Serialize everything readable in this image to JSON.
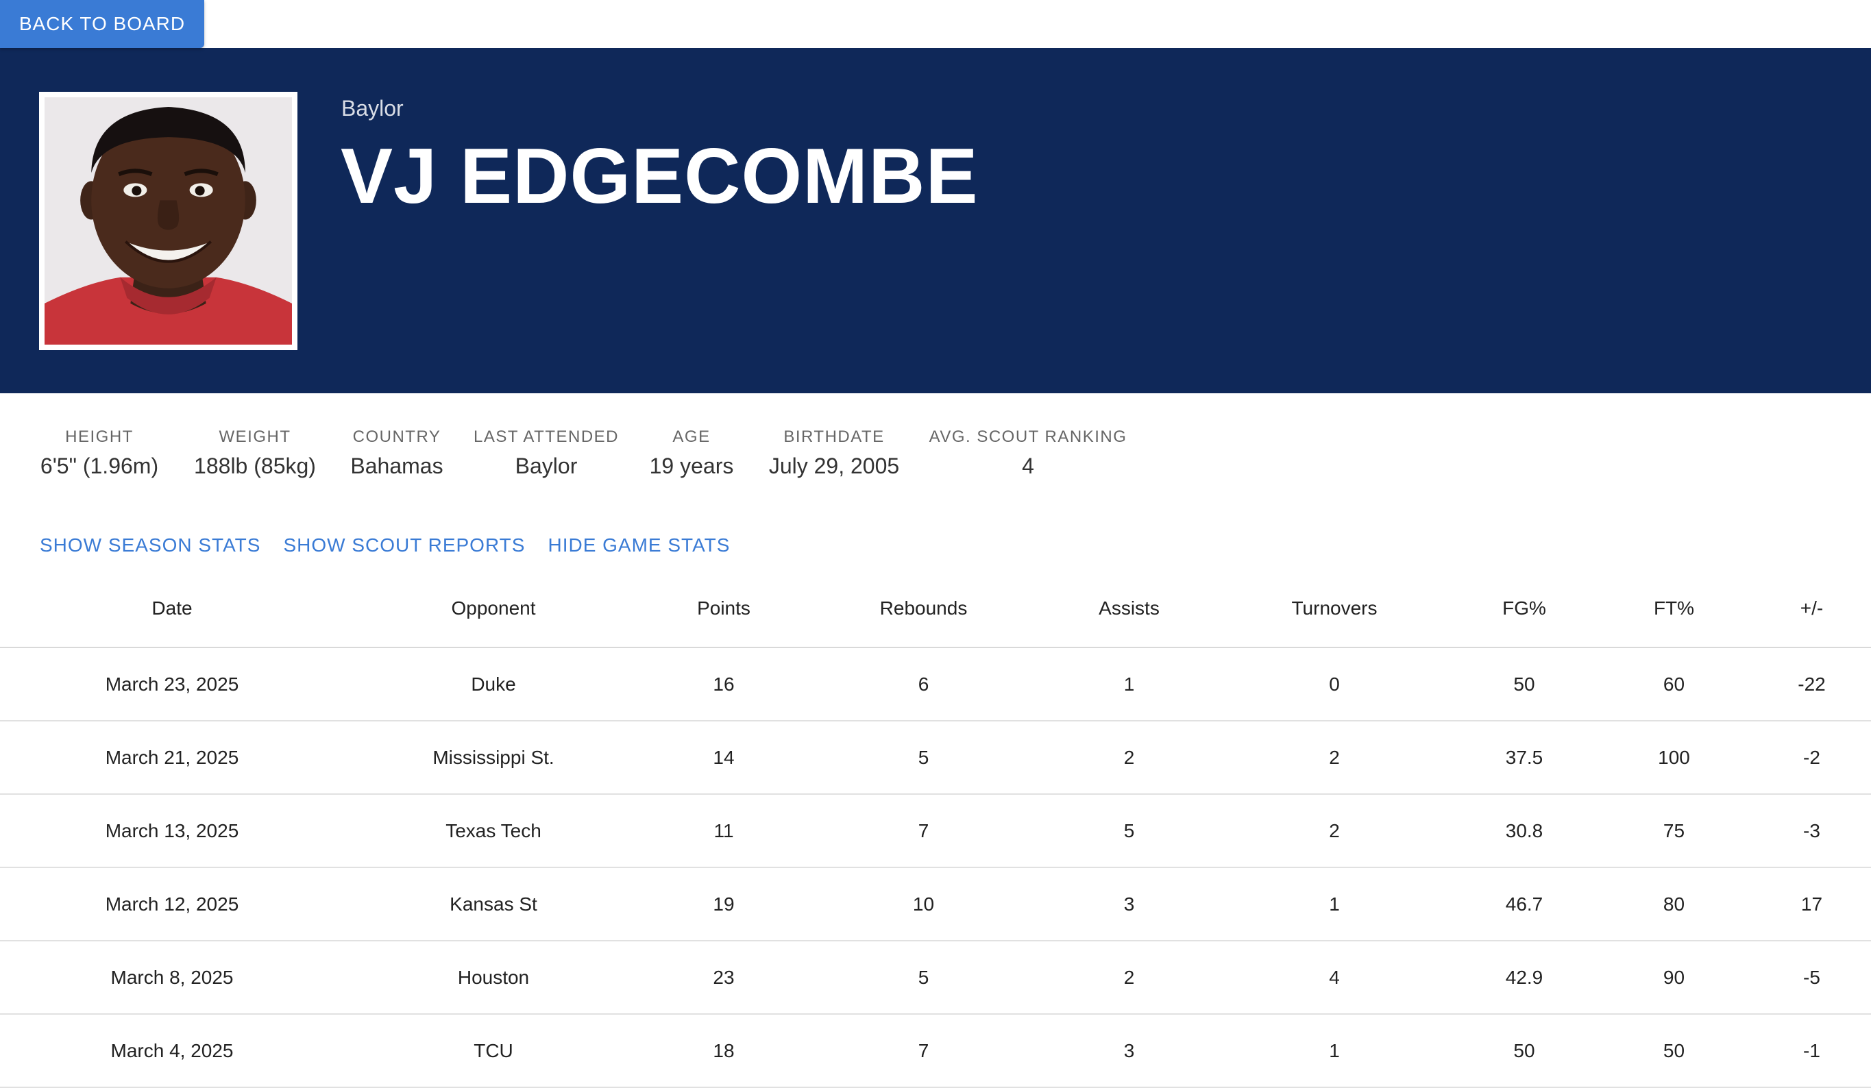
{
  "nav": {
    "back_label": "BACK TO BOARD"
  },
  "player": {
    "school": "Baylor",
    "name": "VJ EDGECOMBE",
    "photo_icon": "player-headshot"
  },
  "bio": [
    {
      "label": "HEIGHT",
      "value": "6'5\" (1.96m)"
    },
    {
      "label": "WEIGHT",
      "value": "188lb (85kg)"
    },
    {
      "label": "COUNTRY",
      "value": "Bahamas"
    },
    {
      "label": "LAST ATTENDED",
      "value": "Baylor"
    },
    {
      "label": "AGE",
      "value": "19 years"
    },
    {
      "label": "BIRTHDATE",
      "value": "July 29, 2005"
    },
    {
      "label": "AVG. SCOUT RANKING",
      "value": "4"
    }
  ],
  "toggles": [
    {
      "label": "SHOW SEASON STATS"
    },
    {
      "label": "SHOW SCOUT REPORTS"
    },
    {
      "label": "HIDE GAME STATS"
    }
  ],
  "game_stats": {
    "columns": [
      "Date",
      "Opponent",
      "Points",
      "Rebounds",
      "Assists",
      "Turnovers",
      "FG%",
      "FT%",
      "+/-"
    ],
    "rows": [
      [
        "March 23, 2025",
        "Duke",
        "16",
        "6",
        "1",
        "0",
        "50",
        "60",
        "-22"
      ],
      [
        "March 21, 2025",
        "Mississippi St.",
        "14",
        "5",
        "2",
        "2",
        "37.5",
        "100",
        "-2"
      ],
      [
        "March 13, 2025",
        "Texas Tech",
        "11",
        "7",
        "5",
        "2",
        "30.8",
        "75",
        "-3"
      ],
      [
        "March 12, 2025",
        "Kansas St",
        "19",
        "10",
        "3",
        "1",
        "46.7",
        "80",
        "17"
      ],
      [
        "March 8, 2025",
        "Houston",
        "23",
        "5",
        "2",
        "4",
        "42.9",
        "90",
        "-5"
      ],
      [
        "March 4, 2025",
        "TCU",
        "18",
        "7",
        "3",
        "1",
        "50",
        "50",
        "-1"
      ]
    ]
  },
  "colors": {
    "banner": "#0f2859",
    "accent": "#3a7bd5",
    "link": "#3a7bd5"
  }
}
